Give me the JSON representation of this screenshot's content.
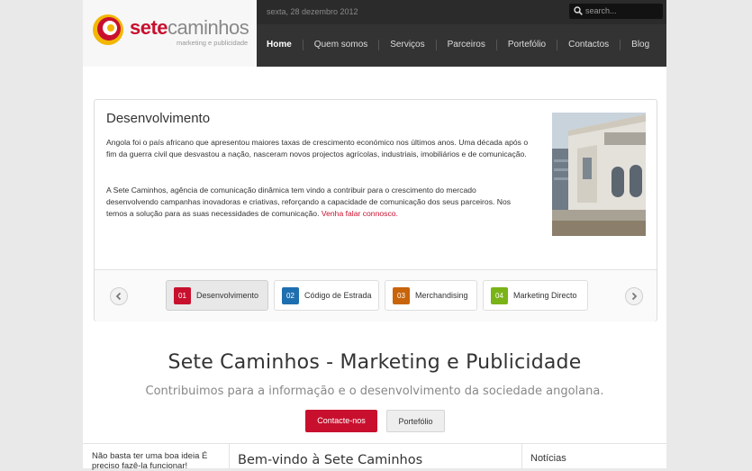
{
  "brand": {
    "name_part1": "sete",
    "name_part2": "caminhos",
    "tagline": "marketing e publicidade",
    "logo_icon": "spiral-logo-icon",
    "colors": {
      "red": "#c8102e",
      "yellow": "#f2b705",
      "dark": "#2b2b2b"
    }
  },
  "header": {
    "date": "sexta, 28 dezembro 2012",
    "search": {
      "placeholder": "search...",
      "icon": "search-icon"
    },
    "nav": [
      {
        "label": "Home",
        "active": true
      },
      {
        "label": "Quem somos"
      },
      {
        "label": "Serviços"
      },
      {
        "label": "Parceiros"
      },
      {
        "label": "Portefólio"
      },
      {
        "label": "Contactos"
      },
      {
        "label": "Blog"
      }
    ]
  },
  "slider": {
    "title": "Desenvolvimento",
    "paragraph1": "Angola foi o país africano que apresentou maiores taxas de crescimento económico nos últimos anos. Uma década após o fim da guerra civil que desvastou a nação, nasceram novos projectos agrícolas, industriais, imobiliários e de comunicação.",
    "paragraph2": "A Sete Caminhos, agência de comunicação dinâmica tem vindo a contribuir para o crescimento do mercado desenvolvendo campanhas inovadoras e criativas, reforçando a capacidade de comunicação dos seus parceiros. Nos temos a solução para as suas necessidades de comunicação.",
    "link": "Venha falar connosco.",
    "prev_icon": "chevron-left-icon",
    "next_icon": "chevron-right-icon",
    "tabs": [
      {
        "num": "01",
        "label": "Desenvolvimento",
        "color": "#c8102e",
        "active": true
      },
      {
        "num": "02",
        "label": "Código de Estrada",
        "color": "#1e6fb0"
      },
      {
        "num": "03",
        "label": "Merchandising",
        "color": "#c8640a"
      },
      {
        "num": "04",
        "label": "Marketing Directo",
        "color": "#7ab317"
      }
    ]
  },
  "hero": {
    "title": "Sete Caminhos - Marketing e Publicidade",
    "subtitle": "Contribuimos para a informação e o desenvolvimento da sociedade angolana.",
    "primary_button": "Contacte-nos",
    "secondary_button": "Portefólio"
  },
  "bottom": {
    "left_text": "Não basta ter uma boa ideia É preciso fazê-la funcionar!",
    "middle_title": "Bem-vindo à Sete Caminhos",
    "right_title": "Notícias"
  }
}
